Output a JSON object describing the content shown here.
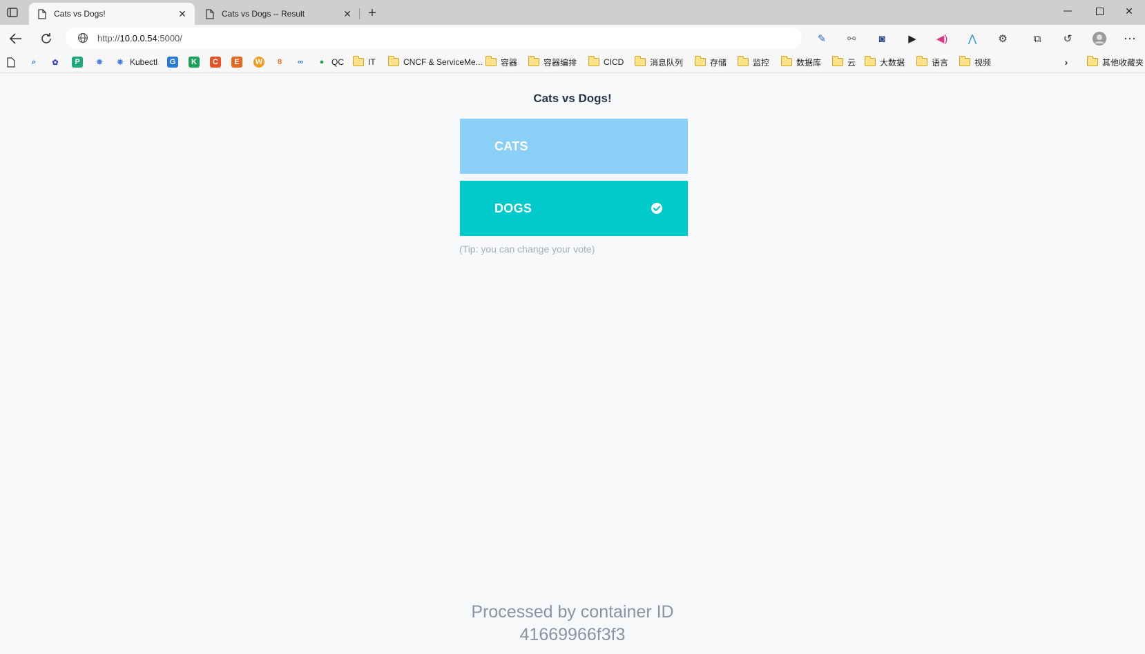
{
  "browser": {
    "tabs": [
      {
        "title": "Cats vs Dogs!",
        "active": true
      },
      {
        "title": "Cats vs Dogs -- Result",
        "active": false
      }
    ],
    "url_prefix": "http://",
    "url_host": "10.0.0.54",
    "url_suffix": ":5000/",
    "bookmarks": [
      {
        "label": "Kubectl",
        "icon": "kubernetes-icon"
      },
      {
        "label": "QC",
        "icon": "person-icon"
      },
      {
        "label": "IT",
        "icon": "folder-icon"
      },
      {
        "label": "CNCF & ServiceMe...",
        "icon": "folder-icon"
      },
      {
        "label": "容器",
        "icon": "folder-icon"
      },
      {
        "label": "容器编排",
        "icon": "folder-icon"
      },
      {
        "label": "CICD",
        "icon": "folder-icon"
      },
      {
        "label": "消息队列",
        "icon": "folder-icon"
      },
      {
        "label": "存储",
        "icon": "folder-icon"
      },
      {
        "label": "监控",
        "icon": "folder-icon"
      },
      {
        "label": "数据库",
        "icon": "folder-icon"
      },
      {
        "label": "云",
        "icon": "folder-icon"
      },
      {
        "label": "大数据",
        "icon": "folder-icon"
      },
      {
        "label": "语言",
        "icon": "folder-icon"
      },
      {
        "label": "视频",
        "icon": "folder-icon"
      },
      {
        "label": "其他收藏夹",
        "icon": "folder-icon"
      }
    ]
  },
  "page": {
    "title": "Cats vs Dogs!",
    "option_a": "CATS",
    "option_b": "DOGS",
    "selected": "DOGS",
    "tip": "(Tip: you can change your vote)",
    "footer_line1": "Processed by container ID",
    "footer_line2": "41669966f3f3"
  },
  "colors": {
    "cats": "#89cff6",
    "dogs": "#00cbca",
    "background": "#f7f8fa"
  }
}
